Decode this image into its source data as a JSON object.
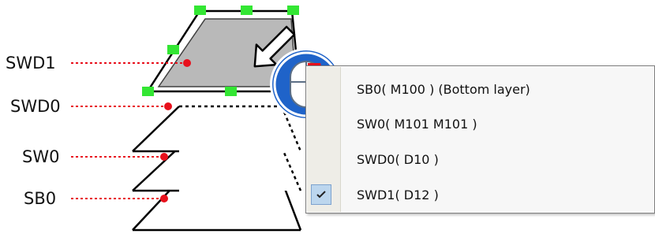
{
  "diagram": {
    "layer_labels": [
      "SWD1",
      "SWD0",
      "SW0",
      "SB0"
    ],
    "colors": {
      "leader_line": "#e8101c",
      "selected_layer_fill": "#b9b9b9",
      "handles": "#33e633",
      "mouse_badge": "#1f63c9",
      "mouse_button": "#e8101c"
    },
    "icons": [
      "move-cursor-icon",
      "mouse-icon"
    ]
  },
  "context_menu": {
    "items": [
      {
        "label": "SB0( M100 ) (Bottom layer)",
        "checked": false
      },
      {
        "label": "SW0( M101 M101 )",
        "checked": false
      },
      {
        "label": "SWD0( D10 )",
        "checked": false
      },
      {
        "label": "SWD1( D12 )",
        "checked": true
      }
    ]
  }
}
